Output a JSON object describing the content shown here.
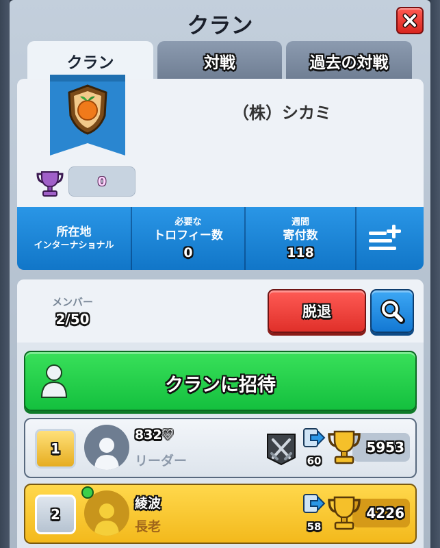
{
  "window": {
    "title": "クラン"
  },
  "tabs": [
    {
      "label": "クラン",
      "active": true
    },
    {
      "label": "対戦",
      "active": false
    },
    {
      "label": "過去の対戦",
      "active": false
    }
  ],
  "clan": {
    "name": "（株）シカミ",
    "trophies": "0",
    "badge_icon": "orange-shield-badge-icon"
  },
  "stats": {
    "location_label": "所在地",
    "location_value": "インターナショナル",
    "required_label_1": "必要な",
    "required_label_2": "トロフィー数",
    "required_value": "0",
    "donations_label_1": "週間",
    "donations_label_2": "寄付数",
    "donations_value": "118"
  },
  "members_section": {
    "label": "メンバー",
    "count": "2/50",
    "leave_label": "脱退",
    "invite_label": "クランに招待"
  },
  "members": [
    {
      "rank": "1",
      "name": "832♡",
      "role": "リーダー",
      "donations": "60",
      "trophies": "5953",
      "online": false
    },
    {
      "rank": "2",
      "name": "綾波",
      "role": "長老",
      "donations": "58",
      "trophies": "4226",
      "online": true
    }
  ],
  "colors": {
    "blue_bar": "#1a86d8",
    "green_button": "#22c94a",
    "red_button": "#e93a33",
    "gold_row": "#f7c52e"
  }
}
